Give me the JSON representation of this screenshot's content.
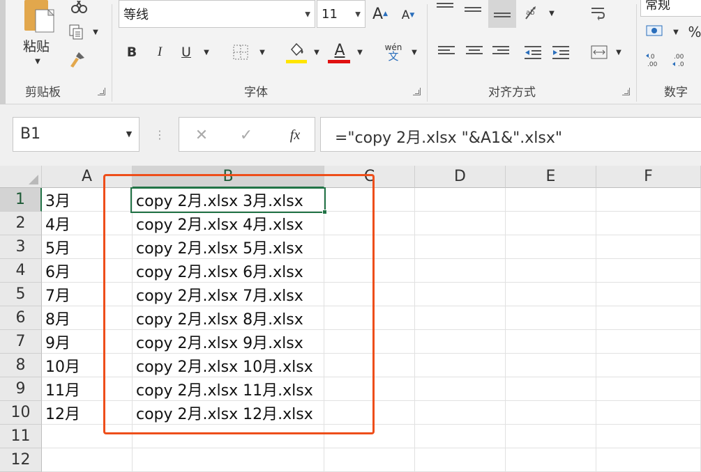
{
  "ribbon": {
    "clipboard": {
      "paste_label": "粘贴",
      "group_label": "剪贴板"
    },
    "font": {
      "font_name": "等线",
      "font_size": "11",
      "grow_label": "A",
      "shrink_label": "A",
      "bold_label": "B",
      "italic_label": "I",
      "underline_label": "U",
      "font_color_label": "A",
      "pinyin_label": "wén",
      "pinyin_char": "文",
      "group_label": "字体",
      "highlight_color": "#ffe500",
      "font_color": "#e01010"
    },
    "alignment": {
      "group_label": "对齐方式"
    },
    "number": {
      "format": "常规",
      "percent_label": "%",
      "group_label": "数字"
    }
  },
  "formula_bar": {
    "name_box": "B1",
    "cancel_label": "✕",
    "enter_label": "✓",
    "fx_label": "fx",
    "formula": "=\"copy 2月.xlsx \"&A1&\".xlsx\""
  },
  "grid": {
    "columns": [
      "A",
      "B",
      "C",
      "D",
      "E",
      "F"
    ],
    "rows": [
      {
        "num": "1",
        "a": "3月",
        "b": "copy 2月.xlsx 3月.xlsx"
      },
      {
        "num": "2",
        "a": "4月",
        "b": "copy 2月.xlsx 4月.xlsx"
      },
      {
        "num": "3",
        "a": "5月",
        "b": "copy 2月.xlsx 5月.xlsx"
      },
      {
        "num": "4",
        "a": "6月",
        "b": "copy 2月.xlsx 6月.xlsx"
      },
      {
        "num": "5",
        "a": "7月",
        "b": "copy 2月.xlsx 7月.xlsx"
      },
      {
        "num": "6",
        "a": "8月",
        "b": "copy 2月.xlsx 8月.xlsx"
      },
      {
        "num": "7",
        "a": "9月",
        "b": "copy 2月.xlsx 9月.xlsx"
      },
      {
        "num": "8",
        "a": "10月",
        "b": "copy 2月.xlsx 10月.xlsx"
      },
      {
        "num": "9",
        "a": "11月",
        "b": "copy 2月.xlsx 11月.xlsx"
      },
      {
        "num": "10",
        "a": "12月",
        "b": "copy 2月.xlsx 12月.xlsx"
      },
      {
        "num": "11",
        "a": "",
        "b": ""
      },
      {
        "num": "12",
        "a": "",
        "b": ""
      }
    ],
    "selected_cell": "B1",
    "accent_color": "#217346",
    "annotation_color": "#ee4e1a"
  }
}
